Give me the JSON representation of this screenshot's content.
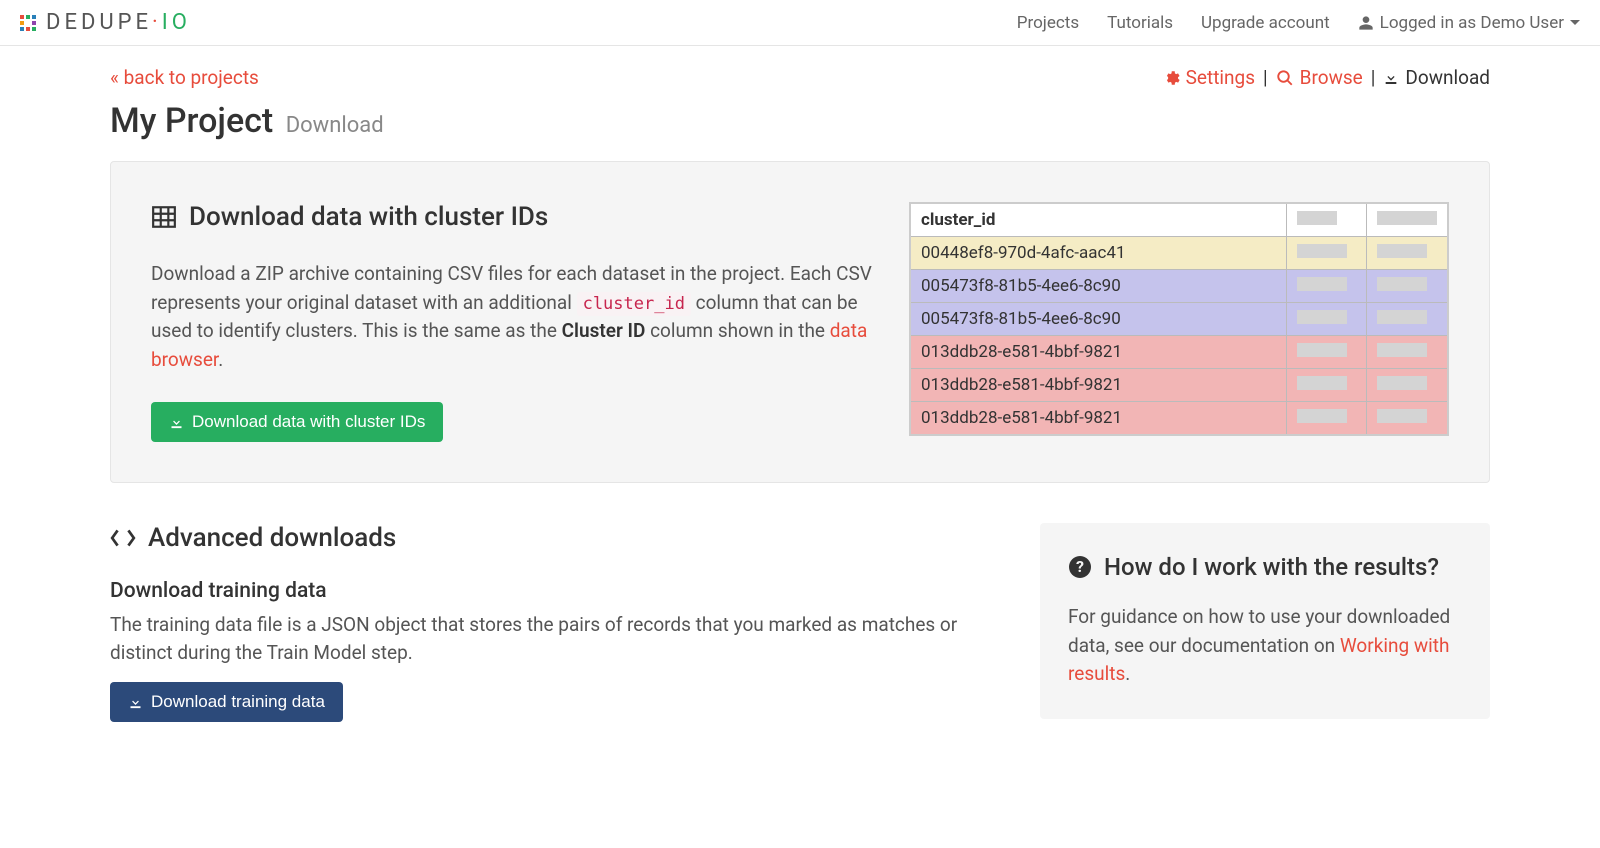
{
  "nav": {
    "brand_pre": "DEDUPE",
    "brand_post": "IO",
    "projects": "Projects",
    "tutorials": "Tutorials",
    "upgrade": "Upgrade account",
    "user_prefix": "Logged in as",
    "user_name": "Demo User"
  },
  "top": {
    "back": "« back to projects",
    "settings": "Settings",
    "browse": "Browse",
    "download": "Download"
  },
  "header": {
    "title": "My Project",
    "subtitle": "Download"
  },
  "panel": {
    "title": "Download data with cluster IDs",
    "desc_1": "Download a ZIP archive containing CSV files for each dataset in the project. Each CSV represents your original dataset with an additional ",
    "desc_code": "cluster_id",
    "desc_2": " column that can be used to identify clusters. This is the same as the ",
    "desc_strong": "Cluster ID",
    "desc_3": " column shown in the ",
    "desc_link": "data browser",
    "desc_4": ".",
    "button": "Download data with cluster IDs",
    "table": {
      "header": "cluster_id",
      "rows": [
        {
          "id": "00448ef8-970d-4afc-aac41",
          "class": "row-yellow"
        },
        {
          "id": "005473f8-81b5-4ee6-8c90",
          "class": "row-purple"
        },
        {
          "id": "005473f8-81b5-4ee6-8c90",
          "class": "row-purple"
        },
        {
          "id": "013ddb28-e581-4bbf-9821",
          "class": "row-pink"
        },
        {
          "id": "013ddb28-e581-4bbf-9821",
          "class": "row-pink"
        },
        {
          "id": "013ddb28-e581-4bbf-9821",
          "class": "row-pink"
        }
      ]
    }
  },
  "advanced": {
    "title": "Advanced downloads",
    "training_h": "Download training data",
    "training_p": "The training data file is a JSON object that stores the pairs of records that you marked as matches or distinct during the Train Model step.",
    "training_btn": "Download training data"
  },
  "help": {
    "title": "How do I work with the results?",
    "p1": "For guidance on how to use your downloaded data, see our documentation on ",
    "link": "Working with results",
    "p2": "."
  }
}
